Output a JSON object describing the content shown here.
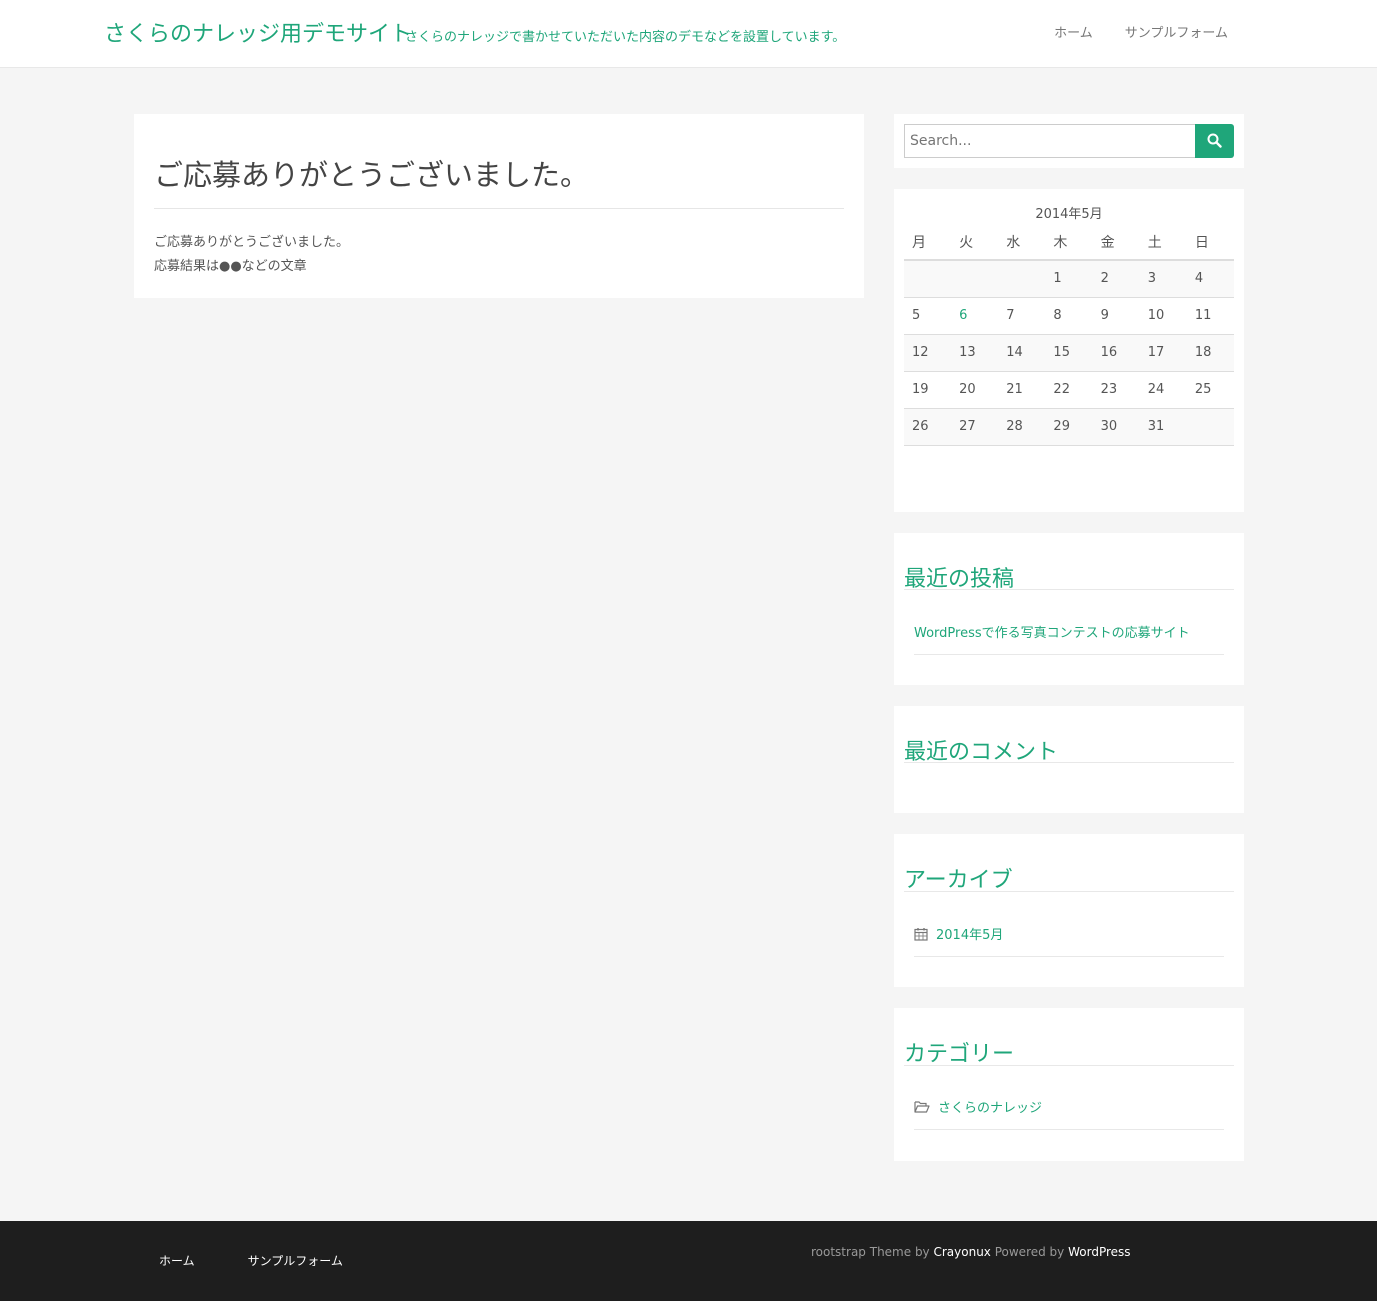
{
  "site": {
    "title": "さくらのナレッジ用デモサイト",
    "description": "さくらのナレッジで書かせていただいた内容のデモなどを設置しています。"
  },
  "nav": [
    {
      "label": "ホーム"
    },
    {
      "label": "サンプルフォーム"
    }
  ],
  "page": {
    "title": "ご応募ありがとうございました。",
    "lines": [
      "ご応募ありがとうございました。",
      "応募結果は●●などの文章"
    ]
  },
  "search": {
    "placeholder": "Search..."
  },
  "calendar": {
    "caption": "2014年5月",
    "weekdays": [
      "月",
      "火",
      "水",
      "木",
      "金",
      "土",
      "日"
    ],
    "weeks": [
      [
        "",
        "",
        "",
        "1",
        "2",
        "3",
        "4"
      ],
      [
        "5",
        "6",
        "7",
        "8",
        "9",
        "10",
        "11"
      ],
      [
        "12",
        "13",
        "14",
        "15",
        "16",
        "17",
        "18"
      ],
      [
        "19",
        "20",
        "21",
        "22",
        "23",
        "24",
        "25"
      ],
      [
        "26",
        "27",
        "28",
        "29",
        "30",
        "31",
        ""
      ]
    ],
    "linked_day": "6"
  },
  "recent_posts": {
    "title": "最近の投稿",
    "items": [
      "WordPressで作る写真コンテストの応募サイト"
    ]
  },
  "recent_comments": {
    "title": "最近のコメント"
  },
  "archives": {
    "title": "アーカイブ",
    "items": [
      "2014年5月"
    ],
    "icon": "calendar-icon"
  },
  "categories": {
    "title": "カテゴリー",
    "items": [
      "さくらのナレッジ"
    ],
    "icon": "folder-open-icon"
  },
  "footer": {
    "nav": [
      {
        "label": "ホーム"
      },
      {
        "label": "サンプルフォーム"
      }
    ],
    "credit": {
      "prefix": "rootstrap Theme by ",
      "theme_author": "Crayonux",
      "middle": " Powered by ",
      "platform": "WordPress"
    }
  },
  "colors": {
    "accent": "#1fa67a",
    "footer_bg": "#1e1e1e",
    "page_bg": "#f5f5f5"
  }
}
